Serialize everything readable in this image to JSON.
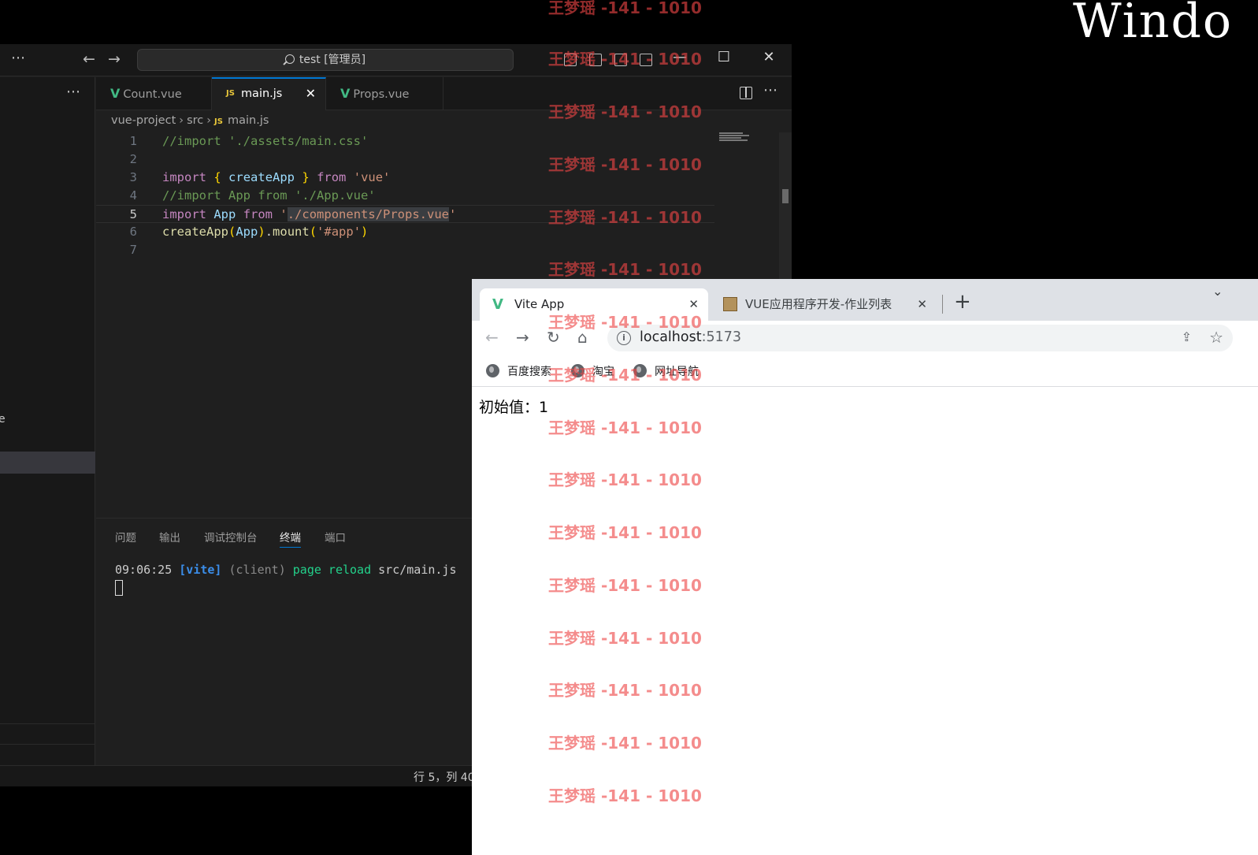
{
  "desktop": {
    "title_fragment": "Windo"
  },
  "vscode": {
    "title_search": "test [管理员]",
    "tabs": [
      {
        "label": "Count.vue",
        "type": "vue"
      },
      {
        "label": "main.js",
        "type": "js",
        "active": true
      },
      {
        "label": "Props.vue",
        "type": "vue"
      }
    ],
    "js_badge": "JS",
    "breadcrumb": {
      "root": "vue-project",
      "folder": "src",
      "file": "main.js"
    },
    "code": {
      "l1": "//import './assets/main.css'",
      "l3_import": "import",
      "l3_open": "{",
      "l3_name": "createApp",
      "l3_close": "}",
      "l3_from": "from",
      "l3_src": "'vue'",
      "l4": "//import App from './App.vue'",
      "l5_import": "import",
      "l5_name": "App",
      "l5_from": "from",
      "l5_q1": "'",
      "l5_path": "./components/Props.vue",
      "l5_q2": "'",
      "l6_fn": "createApp",
      "l6_p1": "(",
      "l6_arg": "App",
      "l6_p2": ")",
      "l6_dot": ".",
      "l6_mount": "mount",
      "l6_p3": "(",
      "l6_sel": "'#app'",
      "l6_p4": ")"
    },
    "line_numbers": [
      "1",
      "2",
      "3",
      "4",
      "5",
      "6",
      "7"
    ],
    "panel_tabs": [
      "问题",
      "输出",
      "调试控制台",
      "终端",
      "端口"
    ],
    "terminal": {
      "time": "09:06:25",
      "tag": "[vite]",
      "client": "(client)",
      "msg": "page reload",
      "file": "src/main.js"
    },
    "status": {
      "position": "行 5，列 40"
    }
  },
  "browser": {
    "tabs": [
      {
        "title": "Vite App"
      },
      {
        "title": "VUE应用程序开发-作业列表"
      }
    ],
    "url_host": "localhost",
    "url_port": ":5173",
    "bookmarks": [
      "百度搜索",
      "淘宝",
      "网址导航"
    ],
    "page": {
      "initial_value": "初始值：1"
    }
  },
  "watermark": {
    "text": "王梦瑶 -141 - 1010"
  },
  "icons": {
    "more": "⋯",
    "back": "←",
    "forward": "→",
    "close": "✕",
    "minimize": "—",
    "maximize": "☐",
    "reload": "↻",
    "home": "⌂",
    "star": "☆",
    "share": "⇪",
    "plus": "+",
    "chevron": "⌄",
    "crumb_sep": "›",
    "vue": "V",
    "info": "i"
  },
  "colors": {
    "vscode_bg": "#1f1f1f",
    "accent": "#0078d4",
    "vue_green": "#41b883",
    "watermark": "#ee4646"
  }
}
